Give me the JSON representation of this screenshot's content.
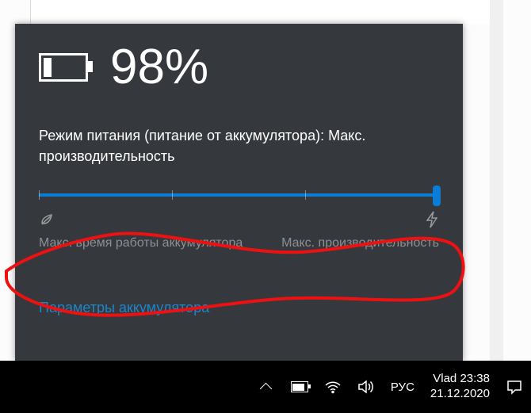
{
  "battery": {
    "percent_label": "98%"
  },
  "power_mode": {
    "text": "Режим питания (питание от аккумулятора): Макс. производительность"
  },
  "slider": {
    "left_label": "Макс. время работы аккумулятора",
    "right_label": "Макс. производительность",
    "position": 1.0
  },
  "link": {
    "battery_settings": "Параметры аккумулятора"
  },
  "taskbar": {
    "language": "РУС",
    "user": "Vlad",
    "time": "23:38",
    "date": "21.12.2020"
  }
}
